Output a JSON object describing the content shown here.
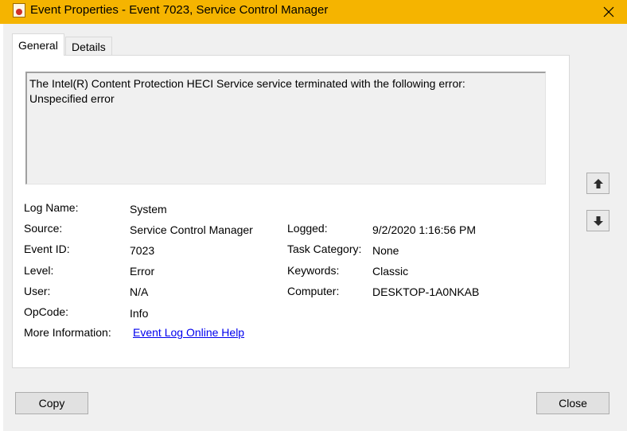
{
  "window": {
    "title": "Event Properties - Event 7023, Service Control Manager",
    "close_glyph": "✕"
  },
  "tabs": [
    {
      "label": "General",
      "active": true
    },
    {
      "label": "Details",
      "active": false
    }
  ],
  "description": {
    "line1": "The Intel(R) Content Protection HECI Service service terminated with the following error:",
    "line2": "Unspecified error"
  },
  "fields": {
    "log_name": {
      "label": "Log Name:",
      "value": "System"
    },
    "source": {
      "label": "Source:",
      "value": "Service Control Manager"
    },
    "event_id": {
      "label": "Event ID:",
      "value": "7023"
    },
    "level": {
      "label": "Level:",
      "value": "Error"
    },
    "user": {
      "label": "User:",
      "value": "N/A"
    },
    "opcode": {
      "label": "OpCode:",
      "value": "Info"
    },
    "more_info": {
      "label": "More Information:",
      "value": "Event Log Online Help"
    },
    "logged": {
      "label": "Logged:",
      "value": "9/2/2020 1:16:56 PM"
    },
    "task_category": {
      "label": "Task Category:",
      "value": "None"
    },
    "keywords": {
      "label": "Keywords:",
      "value": "Classic"
    },
    "computer": {
      "label": "Computer:",
      "value": "DESKTOP-1A0NKAB"
    }
  },
  "buttons": {
    "copy": "Copy",
    "close": "Close"
  },
  "icons": {
    "up": "arrow-up-icon",
    "down": "arrow-down-icon"
  },
  "colors": {
    "titlebar": "#f5b400",
    "link": "#0000ee"
  }
}
